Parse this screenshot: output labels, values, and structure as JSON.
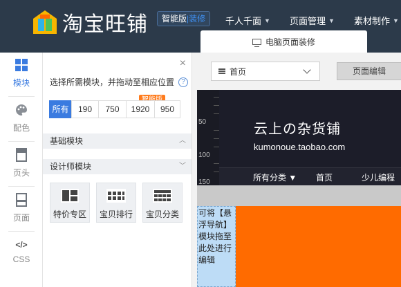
{
  "app": {
    "logo_text": "淘宝旺铺",
    "version_badge_part1": "智能版",
    "version_badge_sep": "|",
    "version_badge_part2": "装修"
  },
  "topnav": [
    {
      "label": "千人千面"
    },
    {
      "label": "页面管理"
    },
    {
      "label": "素材制作"
    }
  ],
  "page_tab": {
    "label": "电脑页面装修"
  },
  "leftbar": [
    {
      "label": "模块",
      "icon": "grid-icon",
      "active": true
    },
    {
      "label": "配色",
      "icon": "palette-icon",
      "active": false
    },
    {
      "label": "页头",
      "icon": "page-header-icon",
      "active": false
    },
    {
      "label": "页面",
      "icon": "page-icon",
      "active": false
    },
    {
      "label": "CSS",
      "icon": "code-icon",
      "active": false
    }
  ],
  "panel": {
    "hint": "选择所需模块，并拖动至相应位置",
    "help": "?",
    "close": "×",
    "widths": [
      "所有",
      "190",
      "750",
      "1920",
      "950"
    ],
    "selected_width": "所有",
    "smart_tag": "智能版",
    "section_basic": "基础模块",
    "section_designer": "设计师模块",
    "modules": [
      {
        "label": "特价专区",
        "icon": "special-offer-icon"
      },
      {
        "label": "宝贝排行",
        "icon": "ranking-icon"
      },
      {
        "label": "宝贝分类",
        "icon": "category-icon"
      }
    ]
  },
  "canvas": {
    "page_select": "首页",
    "edit_button": "页面编辑",
    "ruler": [
      "50",
      "100",
      "150"
    ],
    "store_name": "云上の杂货铺",
    "store_url": "kumonoue.taobao.com",
    "store_nav": [
      "所有分类 ▼",
      "首页",
      "少儿编程"
    ],
    "float_zone_text": "可将【悬浮导航】模块拖至此处进行编辑"
  },
  "colors": {
    "topbar": "#2c3a4a",
    "accent": "#3a7be0",
    "orange": "#ff6b00",
    "store_bg": "#1c1d29",
    "drop_zone": "#bddcf6"
  }
}
